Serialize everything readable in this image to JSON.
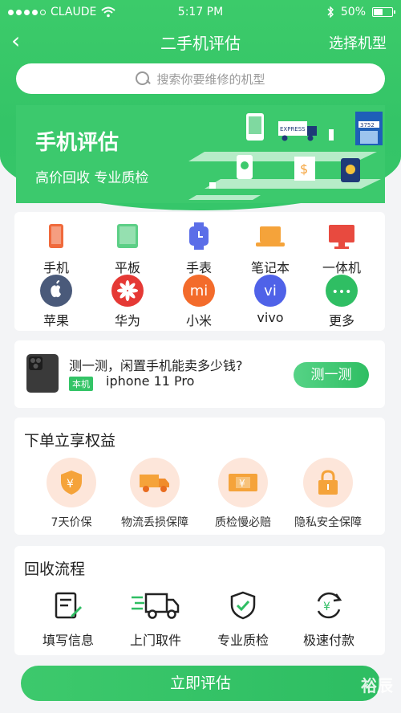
{
  "status": {
    "carrier": "CLAUDE",
    "time": "5:17 PM",
    "battery": "50%",
    "battery_level": 0.5
  },
  "nav": {
    "back": "‹",
    "title": "二手机评估",
    "right": "选择机型"
  },
  "search": {
    "placeholder": "搜索你要维修的机型"
  },
  "banner": {
    "title": "手机评估",
    "subtitle": "高价回收 专业质检",
    "truck_text": "EXPRESS",
    "box_text": "3752"
  },
  "categories": [
    {
      "label": "手机",
      "icon": "phone-icon",
      "color": "#f06a3c"
    },
    {
      "label": "平板",
      "icon": "tablet-icon",
      "color": "#5ccf86"
    },
    {
      "label": "手表",
      "icon": "watch-icon",
      "color": "#5b6ee8"
    },
    {
      "label": "笔记本",
      "icon": "laptop-icon",
      "color": "#f5a33a"
    },
    {
      "label": "一体机",
      "icon": "desktop-icon",
      "color": "#e84a3f"
    },
    {
      "label": "苹果",
      "icon": "apple-icon",
      "color": "#4a5a7a"
    },
    {
      "label": "华为",
      "icon": "huawei-icon",
      "color": "#e53935"
    },
    {
      "label": "小米",
      "icon": "xiaomi-icon",
      "color": "#f36b2b",
      "mark": "mi"
    },
    {
      "label": "vivo",
      "icon": "vivo-icon",
      "color": "#4f62e8",
      "mark": "vi"
    },
    {
      "label": "更多",
      "icon": "more-icon",
      "color": "#2fbe63",
      "mark": "•••"
    }
  ],
  "test": {
    "question": "测一测，闲置手机能卖多少钱?",
    "tag": "本机",
    "model": "iphone 11 Pro",
    "button": "测一测"
  },
  "rights": {
    "title": "下单立享权益",
    "items": [
      {
        "label": "7天价保",
        "icon": "shield-yuan-icon",
        "symbol": "¥"
      },
      {
        "label": "物流丢损保障",
        "icon": "truck-icon"
      },
      {
        "label": "质检慢必赔",
        "icon": "ticket-icon",
        "symbol": "¥"
      },
      {
        "label": "隐私安全保障",
        "icon": "lock-icon"
      }
    ]
  },
  "flow": {
    "title": "回收流程",
    "items": [
      {
        "label": "填写信息",
        "icon": "form-icon"
      },
      {
        "label": "上门取件",
        "icon": "delivery-truck-icon"
      },
      {
        "label": "专业质检",
        "icon": "shield-check-icon"
      },
      {
        "label": "极速付款",
        "icon": "refresh-yuan-icon",
        "symbol": "¥"
      }
    ]
  },
  "cta": {
    "label": "立即评估"
  },
  "watermark": "裕辰"
}
